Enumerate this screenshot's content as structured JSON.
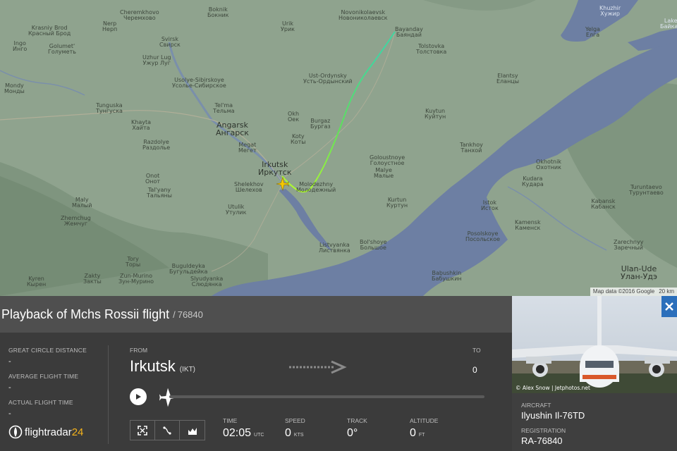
{
  "map": {
    "labels": {
      "cheremkhovo_en": "Cheremkhovo",
      "cheremkhovo_ru": "Черемхово",
      "krasniy_brod_en": "Krasniy Brod",
      "krasniy_brod_ru": "Красный Брод",
      "golumet_en": "Golumet'",
      "golumet_ru": "Голуметь",
      "ingo_en": "Ingo",
      "ingo_ru": "Инго",
      "nerp_en": "Nerp",
      "nerp_ru": "Нерп",
      "svirsk_en": "Svirsk",
      "svirsk_ru": "Свирск",
      "uzhur_en": "Uzhur Lug",
      "uzhur_ru": "Ужур Луг",
      "boknik_en": "Boknik",
      "boknik_ru": "Бокник",
      "urik_en": "Urik",
      "urik_ru": "Урик",
      "novonikolaevsk_en": "Novonikolaevsk",
      "novonikolaevsk_ru": "Новониколаевск",
      "bayanday_en": "Bayanday",
      "bayanday_ru": "Баяндай",
      "tolstovka_en": "Tolstovka",
      "tolstovka_ru": "Толстовка",
      "khuzhir_en": "Khuzhir",
      "khuzhir_ru": "Хужир",
      "yelga_en": "Yelga",
      "yelga_ru": "Елга",
      "baikal_en": "Lake",
      "baikal_ru": "Байкал",
      "usolye_en": "Usolye-Sibirskoye",
      "usolye_ru": "Усолье-Сибирское",
      "ust_ordynsky_en": "Ust-Ordynsky",
      "ust_ordynsky_ru": "Усть-Ордынский",
      "elantsy_en": "Elantsy",
      "elantsy_ru": "Еланцы",
      "tunguska_en": "Tunguska",
      "tunguska_ru": "Тунгуска",
      "telma_en": "Tel'ma",
      "telma_ru": "Тельма",
      "angarsk_en": "Angarsk",
      "angarsk_ru": "Ангарск",
      "kuytun_en": "Kuytun",
      "kuytun_ru": "Куйтун",
      "okhe_en": "Okh",
      "okhe_ru": "Оек",
      "burgaz_en": "Burgaz",
      "burgaz_ru": "Бургаз",
      "kotiny_en": "Koty",
      "kotiny_ru": "Коты",
      "khayta_en": "Khayta",
      "khayta_ru": "Хайта",
      "razdolye_en": "Razdolye",
      "razdolye_ru": "Раздолье",
      "megat_en": "Megat",
      "megat_ru": "Мегет",
      "irkutsk_en": "Irkutsk",
      "irkutsk_ru": "Иркутск",
      "shelekhov_en": "Shelekhov",
      "shelekhov_ru": "Шелехов",
      "molodezhny_en": "Molodezhny",
      "molodezhny_ru": "Молодежный",
      "goloustnoye_en": "Goloustnoye",
      "goloustnoye_ru": "Голоустное",
      "malye_en": "Malye",
      "malye_ru": "Малые",
      "kurtun_en": "Kurtun",
      "kurtun_ru": "Куртун",
      "onot_en": "Onot",
      "onot_ru": "Онот",
      "talyany_en": "Tal'yany",
      "talyany_ru": "Тальяны",
      "listvyanka_en": "Listvyanka",
      "listvyanka_ru": "Листвянка",
      "bolshoye_en": "Bol'shoye",
      "bolshoye_ru": "Большое",
      "koty2_en": "Koty",
      "koty2_ru": "Коты",
      "kudara_en": "Kudara",
      "kudara_ru": "Кудара",
      "istok_en": "Istok",
      "istok_ru": "Исток",
      "kamensk_en": "Kamensk",
      "kamensk_ru": "Каменск",
      "posolskoye_en": "Posolskoye",
      "posolskoye_ru": "Посольское",
      "zarechny_en": "Zarechnyy",
      "zarechny_ru": "Заречный",
      "ulan_ude_en": "Ulan-Ude",
      "ulan_ude_ru": "Улан-Удэ",
      "babushkin_en": "Babushkin",
      "babushkin_ru": "Бабушкин",
      "sludyanka_en": "Slyudyanka",
      "sludyanka_ru": "Слюдянка",
      "kyren_en": "Kyren",
      "kyren_ru": "Кырен",
      "zakty_en": "Zakty",
      "zakty_ru": "Закты",
      "zun_murino_en": "Zun-Murino",
      "zun_murino_ru": "Зун-Мурино",
      "tory_en": "Tory",
      "tory_ru": "Торы",
      "buguldeyka_en": "Buguldeyka",
      "buguldeyka_ru": "Бугульдейка",
      "utulik_en": "Utulik",
      "utulik_ru": "Утулик",
      "zhemchug_en": "Zhemchug",
      "zhemchug_ru": "Жемчуг",
      "maly_en": "Maly",
      "maly_ru": "Малый",
      "okhotnik_en": "Okhotnik",
      "okhotnik_ru": "Охотник",
      "turuntaevo_en": "Turuntaevo",
      "turuntaevo_ru": "Турунтаево",
      "kabansk_en": "Kabansk",
      "kabansk_ru": "Кабанск",
      "tanhoy_en": "Tankhoy",
      "tanhoy_ru": "Танхой",
      "mondy_en": "Mondy",
      "mondy_ru": "Монды"
    },
    "attribution": "Map data ©2016 Google",
    "scale": "20 km"
  },
  "flight": {
    "title": "Playback of Mchs Rossii flight",
    "separator": "/",
    "callsign": "76840"
  },
  "stats": {
    "great_circle_label": "GREAT CIRCLE DISTANCE",
    "great_circle_value": "-",
    "avg_time_label": "AVERAGE FLIGHT TIME",
    "avg_time_value": "-",
    "actual_time_label": "ACTUAL FLIGHT TIME",
    "actual_time_value": "-"
  },
  "logo": {
    "word": "flightradar",
    "num": "24"
  },
  "route": {
    "from_label": "FROM",
    "origin_city": "Irkutsk",
    "origin_code": "(IKT)",
    "to_label": "TO",
    "destination": "0"
  },
  "metrics": {
    "time_label": "TIME",
    "time_value": "02:05",
    "time_unit": "UTC",
    "speed_label": "SPEED",
    "speed_value": "0",
    "speed_unit": "KTS",
    "track_label": "TRACK",
    "track_value": "0°",
    "altitude_label": "ALTITUDE",
    "altitude_value": "0",
    "altitude_unit": "FT"
  },
  "playback": {
    "progress": 0
  },
  "aircraft": {
    "photo_credit": "© Alex Snow | Jetphotos.net",
    "aircraft_label": "AIRCRAFT",
    "aircraft_value": "Ilyushin Il-76TD",
    "registration_label": "REGISTRATION",
    "registration_value": "RA-76840"
  },
  "colors": {
    "map_land": "#8fa38e",
    "lake": "#6d7fa3",
    "track_start": "#b8ff2a",
    "track_end": "#3fd7a0",
    "panel_dark": "#3b3b3b",
    "title_bar": "#4f4f4f",
    "close_blue": "#2b6fbb",
    "logo_yellow": "#f5b31b"
  },
  "icons": [
    "play-icon",
    "plane-icon",
    "arrow-right-icon",
    "fullscreen-icon",
    "route-icon",
    "chart-icon",
    "close-icon"
  ]
}
